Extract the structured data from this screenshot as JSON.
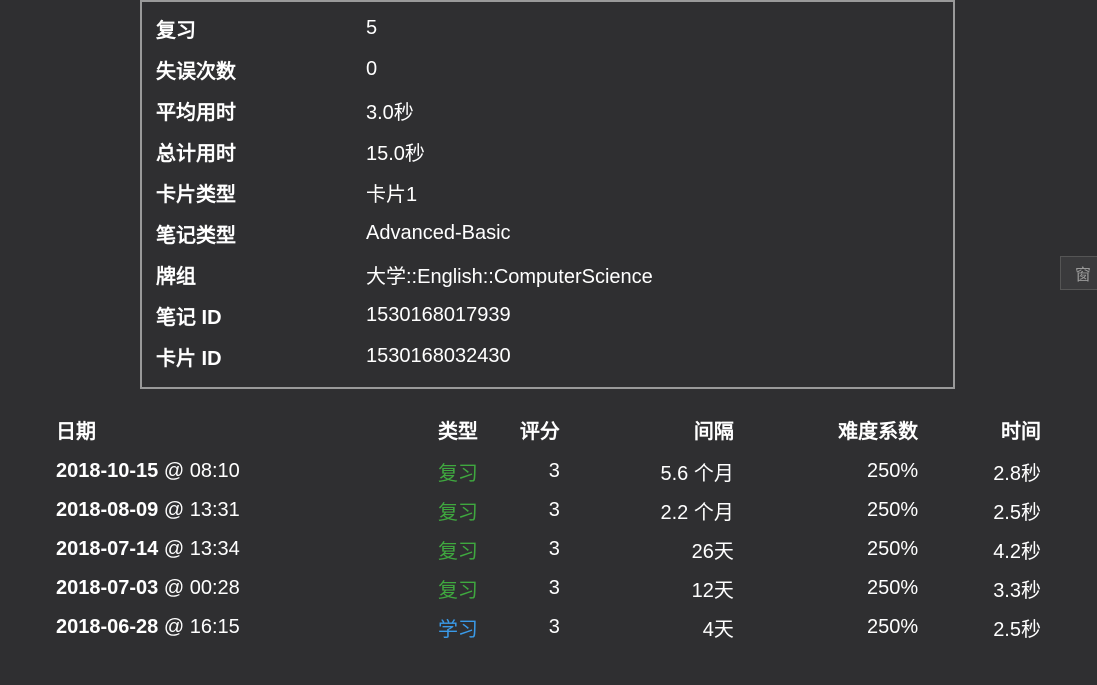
{
  "info": {
    "rows": [
      {
        "label": "复习",
        "value": "5"
      },
      {
        "label": "失误次数",
        "value": "0"
      },
      {
        "label": "平均用时",
        "value": "3.0秒"
      },
      {
        "label": "总计用时",
        "value": "15.0秒"
      },
      {
        "label": "卡片类型",
        "value": "卡片1"
      },
      {
        "label": "笔记类型",
        "value": "Advanced-Basic"
      },
      {
        "label": "牌组",
        "value": "大学::English::ComputerScience"
      },
      {
        "label": "笔记 ID",
        "value": "1530168017939"
      },
      {
        "label": "卡片 ID",
        "value": "1530168032430"
      }
    ]
  },
  "log": {
    "headers": {
      "date": "日期",
      "type": "类型",
      "rating": "评分",
      "interval": "间隔",
      "ease": "难度系数",
      "time": "时间"
    },
    "entries": [
      {
        "date": "2018-10-15",
        "at": "@ 08:10",
        "type": "复习",
        "typeClass": "review",
        "rating": "3",
        "interval": "5.6 个月",
        "ease": "250%",
        "time": "2.8秒"
      },
      {
        "date": "2018-08-09",
        "at": "@ 13:31",
        "type": "复习",
        "typeClass": "review",
        "rating": "3",
        "interval": "2.2 个月",
        "ease": "250%",
        "time": "2.5秒"
      },
      {
        "date": "2018-07-14",
        "at": "@ 13:34",
        "type": "复习",
        "typeClass": "review",
        "rating": "3",
        "interval": "26天",
        "ease": "250%",
        "time": "4.2秒"
      },
      {
        "date": "2018-07-03",
        "at": "@ 00:28",
        "type": "复习",
        "typeClass": "review",
        "rating": "3",
        "interval": "12天",
        "ease": "250%",
        "time": "3.3秒"
      },
      {
        "date": "2018-06-28",
        "at": "@ 16:15",
        "type": "学习",
        "typeClass": "learn",
        "rating": "3",
        "interval": "4天",
        "ease": "250%",
        "time": "2.5秒"
      }
    ]
  },
  "stray": "窗"
}
